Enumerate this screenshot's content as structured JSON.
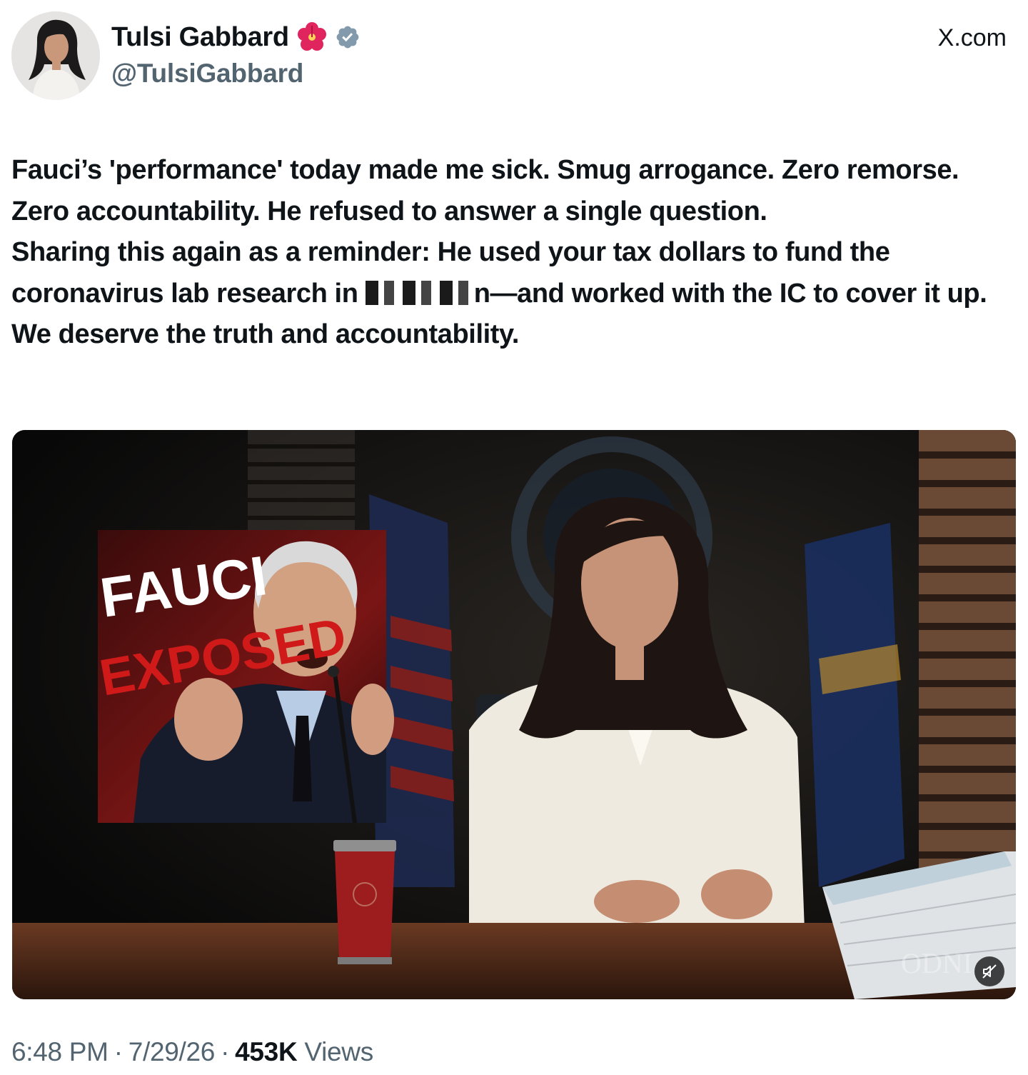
{
  "header": {
    "display_name": "Tulsi Gabbard",
    "handle": "@TulsiGabbard",
    "site": "X.com",
    "name_emoji": "🌺"
  },
  "tweet": {
    "paragraph1": "Fauci’s 'performance' today made me sick. Smug arrogance. Zero remorse. Zero accountability. He refused to answer a single question.",
    "paragraph2_start": "Sharing this again as a reminder: He used your tax dollars to fund the coronavirus lab research in ",
    "paragraph2_end": "n—and worked with the IC to cover it up. We deserve the truth and accountability."
  },
  "media": {
    "thumbnail_title": "FAUCI",
    "thumbnail_subtitle": "EXPOSED",
    "watermark": "ODNI"
  },
  "meta": {
    "time": "6:48 PM",
    "date": "7/29/26",
    "views_count": "453K",
    "views_label": "Views",
    "separator": "·"
  },
  "colors": {
    "verified_blue": "#1d9bf0",
    "muted_text": "#536471",
    "text": "#0f1419"
  }
}
